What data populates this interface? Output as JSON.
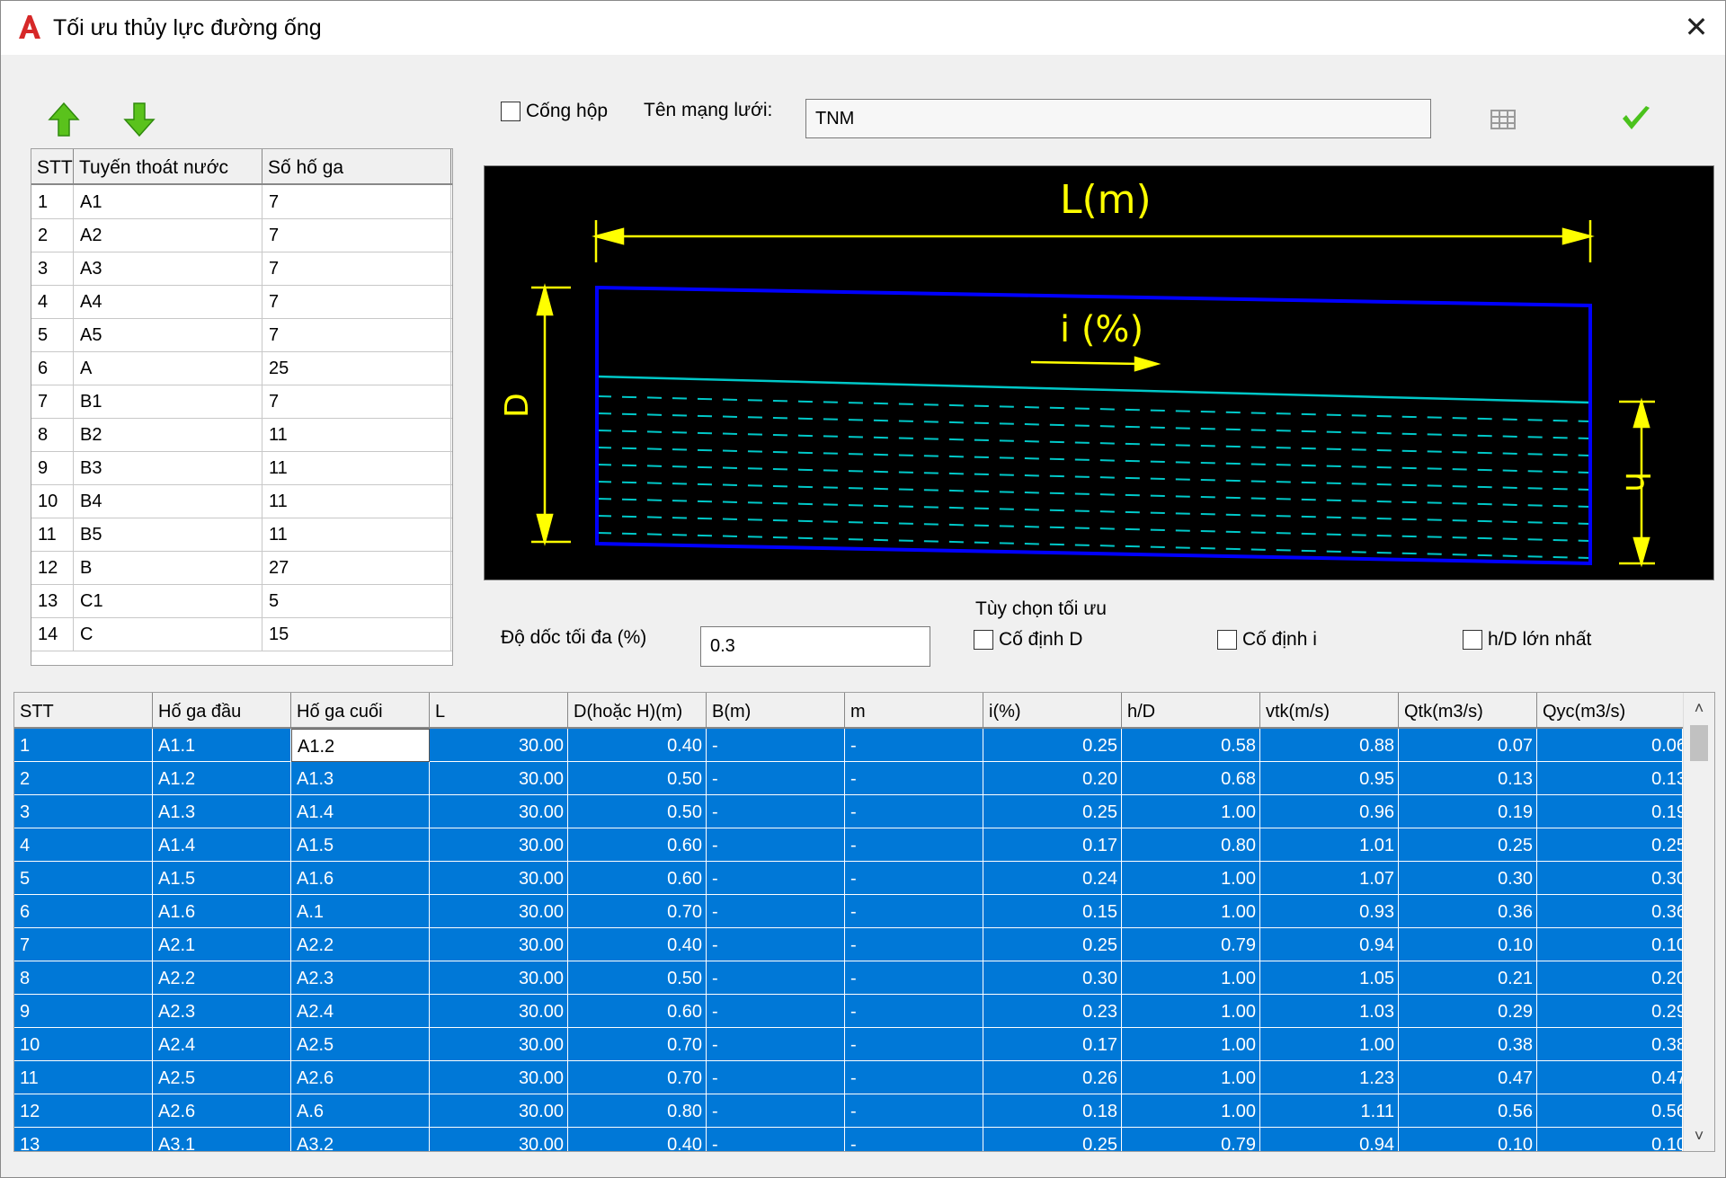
{
  "window": {
    "title": "Tối ưu thủy lực đường ống",
    "close_glyph": "✕"
  },
  "toolbar": {
    "move_up_icon": "green-up-arrow-icon",
    "move_down_icon": "green-down-arrow-icon",
    "box_culvert_label": "Cống hộp",
    "network_name_label": "Tên mạng lưới:",
    "network_name_value": "TNM",
    "export_icon": "table-export-icon",
    "confirm_icon": "green-check-icon"
  },
  "routes": {
    "headers": [
      "STT",
      "Tuyến thoát nước",
      "Số hố ga"
    ],
    "rows": [
      [
        "1",
        "A1",
        "7"
      ],
      [
        "2",
        "A2",
        "7"
      ],
      [
        "3",
        "A3",
        "7"
      ],
      [
        "4",
        "A4",
        "7"
      ],
      [
        "5",
        "A5",
        "7"
      ],
      [
        "6",
        "A",
        "25"
      ],
      [
        "7",
        "B1",
        "7"
      ],
      [
        "8",
        "B2",
        "11"
      ],
      [
        "9",
        "B3",
        "11"
      ],
      [
        "10",
        "B4",
        "11"
      ],
      [
        "11",
        "B5",
        "11"
      ],
      [
        "12",
        "B",
        "27"
      ],
      [
        "13",
        "C1",
        "5"
      ],
      [
        "14",
        "C",
        "15"
      ]
    ]
  },
  "diagram": {
    "length_label": "L(m)",
    "slope_label": "i (%)",
    "diameter_label": "D",
    "depth_label": "h",
    "colors": {
      "background": "#000000",
      "dimension": "#ffff00",
      "pipe": "#0000ff",
      "water": "#00c8c8"
    }
  },
  "options": {
    "max_slope_label": "Độ dốc tối đa (%)",
    "max_slope_value": "0.3",
    "group_label": "Tùy chọn tối ưu",
    "fix_d_label": "Cố định D",
    "fix_i_label": "Cố định i",
    "max_hd_label": "h/D lớn nhất"
  },
  "results": {
    "headers": [
      "STT",
      "Hố ga đầu",
      "Hố ga cuối",
      "L",
      "D(hoặc H)(m)",
      "B(m)",
      "m",
      "i(%)",
      "h/D",
      "vtk(m/s)",
      "Qtk(m3/s)",
      "Qyc(m3/s)"
    ],
    "rows": [
      [
        "1",
        "A1.1",
        "A1.2",
        "30.00",
        "0.40",
        "-",
        "-",
        "0.25",
        "0.58",
        "0.88",
        "0.07",
        "0.06"
      ],
      [
        "2",
        "A1.2",
        "A1.3",
        "30.00",
        "0.50",
        "-",
        "-",
        "0.20",
        "0.68",
        "0.95",
        "0.13",
        "0.13"
      ],
      [
        "3",
        "A1.3",
        "A1.4",
        "30.00",
        "0.50",
        "-",
        "-",
        "0.25",
        "1.00",
        "0.96",
        "0.19",
        "0.19"
      ],
      [
        "4",
        "A1.4",
        "A1.5",
        "30.00",
        "0.60",
        "-",
        "-",
        "0.17",
        "0.80",
        "1.01",
        "0.25",
        "0.25"
      ],
      [
        "5",
        "A1.5",
        "A1.6",
        "30.00",
        "0.60",
        "-",
        "-",
        "0.24",
        "1.00",
        "1.07",
        "0.30",
        "0.30"
      ],
      [
        "6",
        "A1.6",
        "A.1",
        "30.00",
        "0.70",
        "-",
        "-",
        "0.15",
        "1.00",
        "0.93",
        "0.36",
        "0.36"
      ],
      [
        "7",
        "A2.1",
        "A2.2",
        "30.00",
        "0.40",
        "-",
        "-",
        "0.25",
        "0.79",
        "0.94",
        "0.10",
        "0.10"
      ],
      [
        "8",
        "A2.2",
        "A2.3",
        "30.00",
        "0.50",
        "-",
        "-",
        "0.30",
        "1.00",
        "1.05",
        "0.21",
        "0.20"
      ],
      [
        "9",
        "A2.3",
        "A2.4",
        "30.00",
        "0.60",
        "-",
        "-",
        "0.23",
        "1.00",
        "1.03",
        "0.29",
        "0.29"
      ],
      [
        "10",
        "A2.4",
        "A2.5",
        "30.00",
        "0.70",
        "-",
        "-",
        "0.17",
        "1.00",
        "1.00",
        "0.38",
        "0.38"
      ],
      [
        "11",
        "A2.5",
        "A2.6",
        "30.00",
        "0.70",
        "-",
        "-",
        "0.26",
        "1.00",
        "1.23",
        "0.47",
        "0.47"
      ],
      [
        "12",
        "A2.6",
        "A.6",
        "30.00",
        "0.80",
        "-",
        "-",
        "0.18",
        "1.00",
        "1.11",
        "0.56",
        "0.56"
      ],
      [
        "13",
        "A3.1",
        "A3.2",
        "30.00",
        "0.40",
        "-",
        "-",
        "0.25",
        "0.79",
        "0.94",
        "0.10",
        "0.10"
      ]
    ],
    "selected_color": "#0078d7"
  }
}
